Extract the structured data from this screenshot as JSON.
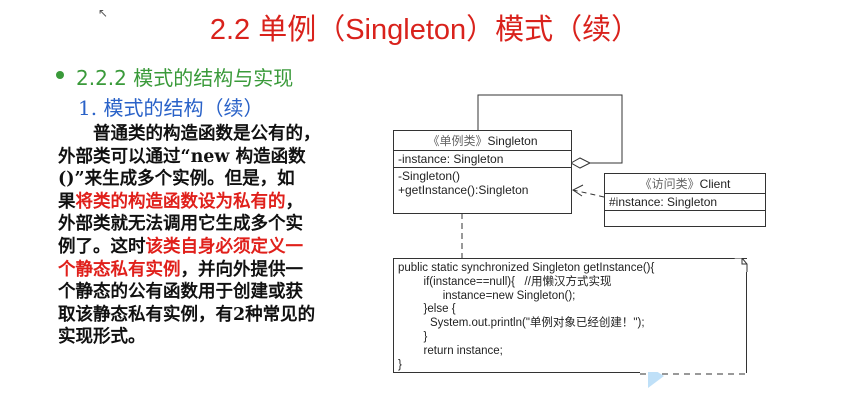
{
  "slide": {
    "title": "2.2 单例（Singleton）模式（续）",
    "bullet": "2.2.2 模式的结构与实现",
    "subheading": "1. 模式的结构（续）",
    "paragraph": [
      [
        {
          "t": "　　普通类的构造函数是公有的，",
          "red": false
        }
      ],
      [
        {
          "t": "外部类可以通过“new 构造函数",
          "red": false
        }
      ],
      [
        {
          "t": "()”来生成多个实例。但是，如",
          "red": false
        }
      ],
      [
        {
          "t": "果",
          "red": false
        },
        {
          "t": "将类的构造函数设为私有的",
          "red": true
        },
        {
          "t": "，",
          "red": false
        }
      ],
      [
        {
          "t": "外部类就无法调用它生成多个实",
          "red": false
        }
      ],
      [
        {
          "t": "例了。这时",
          "red": false
        },
        {
          "t": "该类自身必须定义一",
          "red": true
        }
      ],
      [
        {
          "t": "个静态私有实例",
          "red": true
        },
        {
          "t": "，并向外提供一",
          "red": false
        }
      ],
      [
        {
          "t": "个静态的公有函数用于创建或获",
          "red": false
        }
      ],
      [
        {
          "t": "取该静态私有实例，有2种常见的",
          "red": false
        }
      ],
      [
        {
          "t": "实现形式。",
          "red": false
        }
      ]
    ]
  },
  "diagram": {
    "singleton": {
      "stereotype": "《单例类》",
      "name": "Singleton",
      "attribute": "-instance: Singleton",
      "methods": [
        "-Singleton()",
        "+getInstance():Singleton"
      ]
    },
    "client": {
      "stereotype": "《访问类》",
      "name": "Client",
      "attribute": "#instance: Singleton"
    },
    "note": [
      "public static synchronized Singleton getInstance(){",
      "        if(instance==null){   //用懒汉方式实现",
      "              instance=new Singleton();",
      "        }else {",
      "          System.out.println(\"单例对象已经创建！\");",
      "        }",
      "        return instance;",
      "}"
    ]
  },
  "colors": {
    "title": "#d9221c",
    "bullet": "#3a9a3a",
    "subheading": "#2a62c8",
    "highlight": "#e0201b"
  }
}
